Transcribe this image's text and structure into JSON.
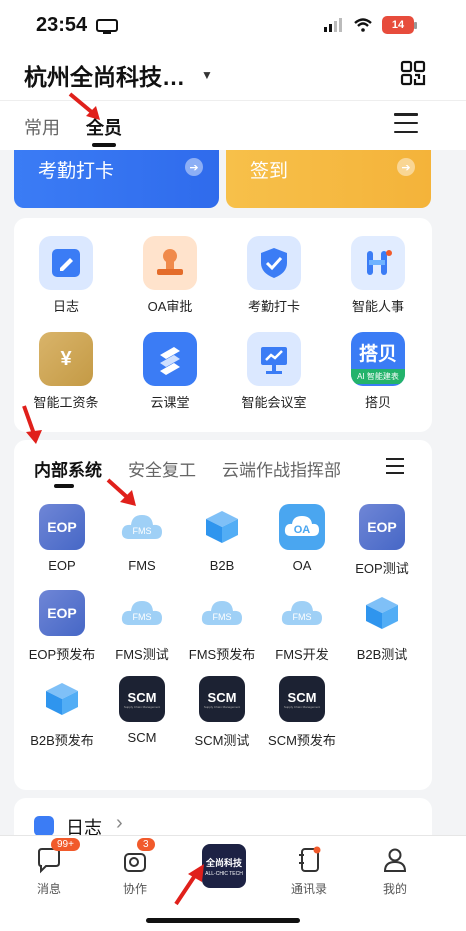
{
  "status_bar": {
    "time": "23:54",
    "battery": "14"
  },
  "header": {
    "org_name": "杭州全尚科技…"
  },
  "top_tabs": [
    {
      "label": "常用"
    },
    {
      "label": "全员"
    }
  ],
  "big_cards": [
    {
      "label": "考勤打卡"
    },
    {
      "label": "签到"
    }
  ],
  "apps": [
    {
      "label": "日志"
    },
    {
      "label": "OA审批"
    },
    {
      "label": "考勤打卡"
    },
    {
      "label": "智能人事"
    },
    {
      "label": "智能工资条"
    },
    {
      "label": "云课堂"
    },
    {
      "label": "智能会议室"
    },
    {
      "label": "搭贝"
    }
  ],
  "app_icon_text": {
    "payroll": "¥",
    "dabei": "搭贝",
    "dabei_sub": "AI 智能建表"
  },
  "systems": {
    "tabs": [
      {
        "label": "内部系统"
      },
      {
        "label": "安全复工"
      },
      {
        "label": "云端作战指挥部"
      }
    ],
    "items": [
      {
        "label": "EOP"
      },
      {
        "label": "FMS"
      },
      {
        "label": "B2B"
      },
      {
        "label": "OA"
      },
      {
        "label": "EOP测试"
      },
      {
        "label": "EOP预发布"
      },
      {
        "label": "FMS测试"
      },
      {
        "label": "FMS预发布"
      },
      {
        "label": "FMS开发"
      },
      {
        "label": "B2B测试"
      },
      {
        "label": "B2B预发布"
      },
      {
        "label": "SCM"
      },
      {
        "label": "SCM测试"
      },
      {
        "label": "SCM预发布"
      }
    ]
  },
  "icon_text": {
    "eop": "EOP",
    "fms": "FMS",
    "oa": "OA",
    "scm": "SCM",
    "scm_sub": "Supply Chain Management"
  },
  "log_section": {
    "title": "日志"
  },
  "bottom_nav": {
    "messages": {
      "label": "消息",
      "badge": "99+"
    },
    "collab": {
      "label": "协作",
      "badge": "3"
    },
    "center_logo": {
      "line1": "全尚科技",
      "line2": "ALL-CHIC TECH"
    },
    "contacts": {
      "label": "通讯录"
    },
    "me": {
      "label": "我的"
    }
  },
  "colors": {
    "accent_blue": "#3b7cf5",
    "accent_orange": "#f4b33a",
    "badge_red": "#f15a2b",
    "arrow_red": "#e0201b"
  }
}
